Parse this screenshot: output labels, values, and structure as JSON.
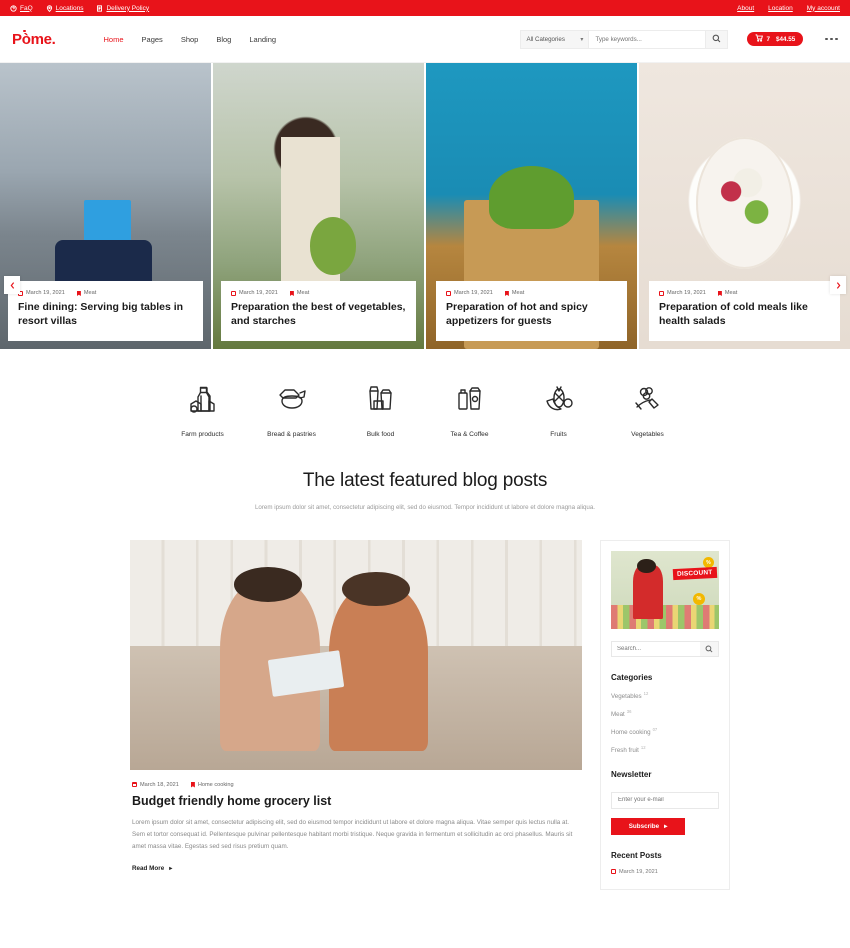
{
  "topbar": {
    "left_items": [
      {
        "label": "FaQ",
        "icon": "help-icon"
      },
      {
        "label": "Locations",
        "icon": "map-pin-icon"
      },
      {
        "label": "Delivery Policy",
        "icon": "document-icon"
      }
    ],
    "right_items": [
      {
        "label": "About"
      },
      {
        "label": "Location"
      },
      {
        "label": "My account"
      }
    ],
    "background": "#e8131a"
  },
  "header": {
    "logo": "Pòme.",
    "nav": [
      {
        "label": "Home",
        "active": true
      },
      {
        "label": "Pages",
        "active": false
      },
      {
        "label": "Shop",
        "active": false
      },
      {
        "label": "Blog",
        "active": false
      },
      {
        "label": "Landing",
        "active": false
      }
    ],
    "search": {
      "category_selected": "All Categories",
      "keyword_placeholder": "Type keywords...",
      "keyword_value": ""
    },
    "cart": {
      "count": "7",
      "amount": "$44.55"
    },
    "accent": "#e8131a"
  },
  "hero": {
    "prev_label": "‹",
    "next_label": "›",
    "slides": [
      {
        "date": "March 19, 2021",
        "category": "Meat",
        "title": "Fine dining: Serving big tables in resort villas"
      },
      {
        "date": "March 19, 2021",
        "category": "Meat",
        "title": "Preparation the best of vegetables, and starches"
      },
      {
        "date": "March 19, 2021",
        "category": "Meat",
        "title": "Preparation of hot and spicy appetizers for guests"
      },
      {
        "date": "March 19, 2021",
        "category": "Meat",
        "title": "Preparation of cold meals like health salads"
      }
    ]
  },
  "categories_row": [
    {
      "label": "Farm products",
      "icon": "milk-cheese-icon"
    },
    {
      "label": "Bread & pastries",
      "icon": "bread-icon"
    },
    {
      "label": "Bulk food",
      "icon": "bulk-bags-icon"
    },
    {
      "label": "Tea & Coffee",
      "icon": "tea-coffee-icon"
    },
    {
      "label": "Fruits",
      "icon": "pineapple-banana-icon"
    },
    {
      "label": "Vegetables",
      "icon": "carrot-broccoli-icon"
    }
  ],
  "section": {
    "title": "The latest featured blog posts",
    "subtitle": "Lorem ipsum dolor sit amet, consectetur adipiscing elit, sed do eiusmod. Tempor incididunt ut labore et dolore magna aliqua."
  },
  "post": {
    "date": "March 18, 2021",
    "category": "Home cooking",
    "title": "Budget friendly home grocery list",
    "excerpt": "Lorem ipsum dolor sit amet, consectetur adipiscing elit, sed do eiusmod tempor incididunt ut labore et dolore magna aliqua. Vitae semper quis lectus nulla at. Sem et tortor consequat id. Pellentesque pulvinar pellentesque habitant morbi tristique. Neque gravida in fermentum et sollicitudin ac orci phasellus. Mauris sit amet massa vitae. Egestas sed sed risus pretium quam.",
    "read_more": "Read More"
  },
  "sidebar": {
    "promo": {
      "badge": "DISCOUNT",
      "pct_1": "%",
      "pct_2": "%"
    },
    "search_placeholder": "Search...",
    "categories_title": "Categories",
    "categories": [
      {
        "label": "Vegetables",
        "count": "12"
      },
      {
        "label": "Meat",
        "count": "36"
      },
      {
        "label": "Home cooking",
        "count": "07"
      },
      {
        "label": "Fresh fruit",
        "count": "12"
      }
    ],
    "newsletter_title": "Newsletter",
    "newsletter_placeholder": "Enter your e-mail",
    "subscribe_label": "Subscribe",
    "recent_title": "Recent Posts",
    "recent_posts": [
      {
        "date": "March 19, 2021"
      }
    ]
  }
}
